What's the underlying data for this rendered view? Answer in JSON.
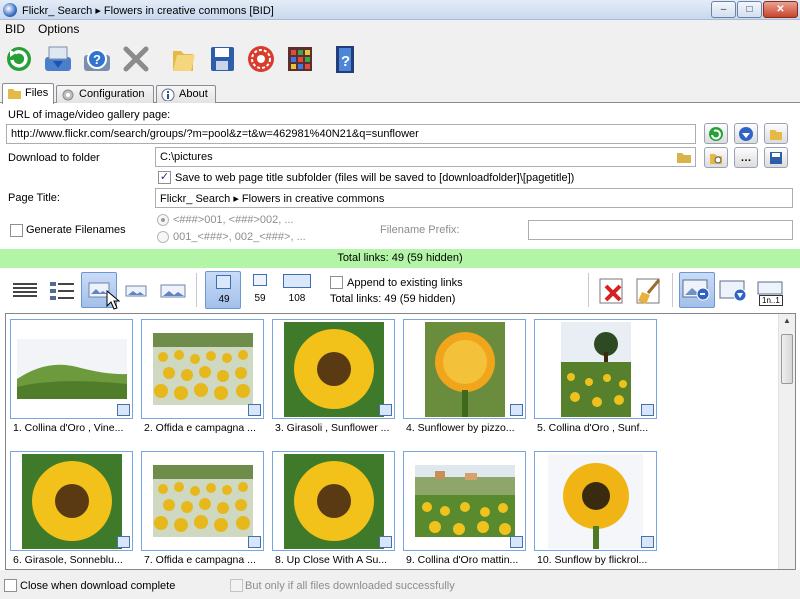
{
  "window": {
    "title": "Flickr_ Search ▸ Flowers in creative commons [BID]",
    "minimize": "–",
    "maximize": "□",
    "close": "✕"
  },
  "menu": {
    "items": [
      "BID",
      "Options"
    ]
  },
  "toolbar": {
    "icons": [
      "refresh-icon",
      "download-icon",
      "help-icon",
      "cancel-icon",
      "folder-icon",
      "save-icon",
      "settings-icon",
      "grid-icon",
      "info-icon"
    ]
  },
  "tabs": [
    {
      "label": "Files",
      "icon": "folder-icon"
    },
    {
      "label": "Configuration",
      "icon": "gear-icon"
    },
    {
      "label": "About",
      "icon": "info-icon"
    }
  ],
  "form": {
    "url_label": "URL of image/video gallery page:",
    "url_value": "http://www.flickr.com/search/groups/?m=pool&z=t&w=462981%40N21&q=sunflower",
    "download_label": "Download to folder",
    "download_value": "C:\\pictures",
    "subfolder_check": "✓",
    "subfolder_label": "Save to web page title subfolder (files will be saved to [downloadfolder]\\[pagetitle])",
    "page_title_label": "Page Title:",
    "page_title_value": "Flickr_ Search ▸ Flowers in creative commons",
    "generate_label": "Generate Filenames",
    "radio1": "<###>001, <###>002, ...",
    "radio2": "001_<###>, 002_<###>, ...",
    "prefix_label": "Filename Prefix:"
  },
  "status": {
    "total": "Total links: 49 (59 hidden)"
  },
  "view": {
    "counts": [
      "49",
      "59",
      "108"
    ],
    "append_label": "Append to existing links",
    "total": "Total links: 49 (59 hidden)",
    "tag": "1n..1"
  },
  "gallery": {
    "items": [
      {
        "caption": "1. Collina d'Oro ,  Vine...",
        "kind": "hill"
      },
      {
        "caption": "2. Offida e campagna ...",
        "kind": "field"
      },
      {
        "caption": "3. Girasoli , Sunflower ...",
        "kind": "sunflower"
      },
      {
        "caption": "4. Sunflower by pizzo...",
        "kind": "bloom"
      },
      {
        "caption": "5. Collina d'Oro ,  Sunf...",
        "kind": "tree"
      },
      {
        "caption": "6. Girasole, Sonneblu...",
        "kind": "sunflower"
      },
      {
        "caption": "7. Offida e campagna ...",
        "kind": "field"
      },
      {
        "caption": "8. Up Close With A Su...",
        "kind": "sunflower"
      },
      {
        "caption": "9. Collina d'Oro mattin...",
        "kind": "village"
      },
      {
        "caption": "10. Sunflow by flickrol...",
        "kind": "sky"
      }
    ]
  },
  "footer": {
    "close_label": "Close when download complete",
    "only_label": "But only if all files downloaded successfully"
  }
}
